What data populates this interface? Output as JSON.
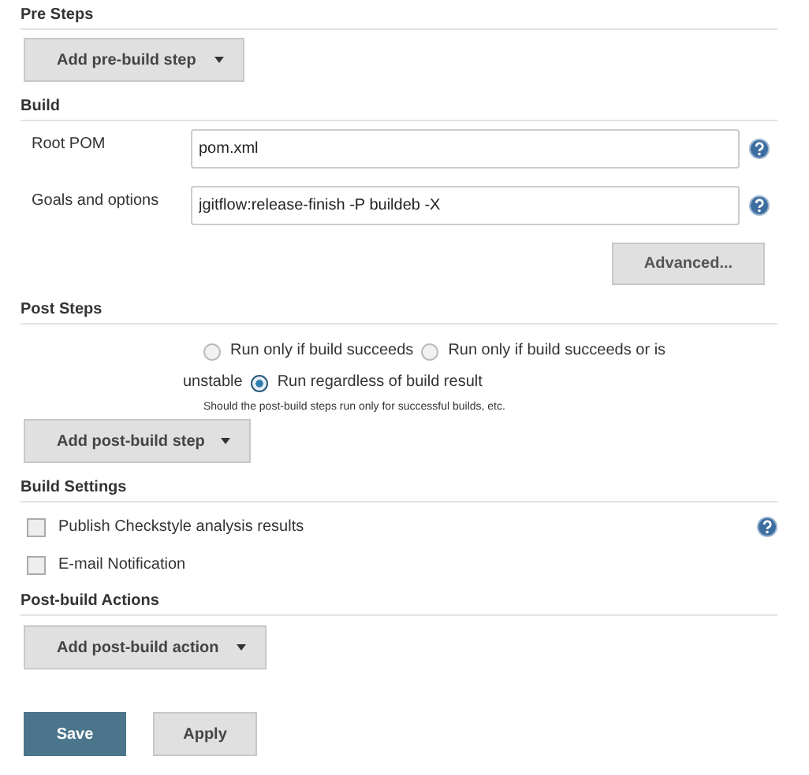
{
  "pre_steps": {
    "title": "Pre Steps",
    "button": "Add pre-build step"
  },
  "build": {
    "title": "Build",
    "fields": [
      {
        "label": "Root POM",
        "value": "pom.xml",
        "help": true
      },
      {
        "label": "Goals and options",
        "value": "jgitflow:release-finish -P buildeb -X",
        "help": true
      }
    ],
    "advanced_button": "Advanced..."
  },
  "post_steps": {
    "title": "Post Steps",
    "options": [
      {
        "label": "Run only if build succeeds",
        "selected": false
      },
      {
        "label": "Run only if build succeeds or is",
        "label_continued": "unstable",
        "selected": false
      },
      {
        "label": "Run regardless of build result",
        "selected": true
      }
    ],
    "hint": "Should the post-build steps run only for successful builds, etc.",
    "button": "Add post-build step"
  },
  "build_settings": {
    "title": "Build Settings",
    "items": [
      {
        "label": "Publish Checkstyle analysis results",
        "checked": false,
        "help": true
      },
      {
        "label": "E-mail Notification",
        "checked": false,
        "help": false
      }
    ]
  },
  "post_build_actions": {
    "title": "Post-build Actions",
    "button": "Add post-build action"
  },
  "buttons": [
    {
      "label": "Save",
      "kind": "primary"
    },
    {
      "label": "Apply",
      "kind": "secondary"
    }
  ]
}
